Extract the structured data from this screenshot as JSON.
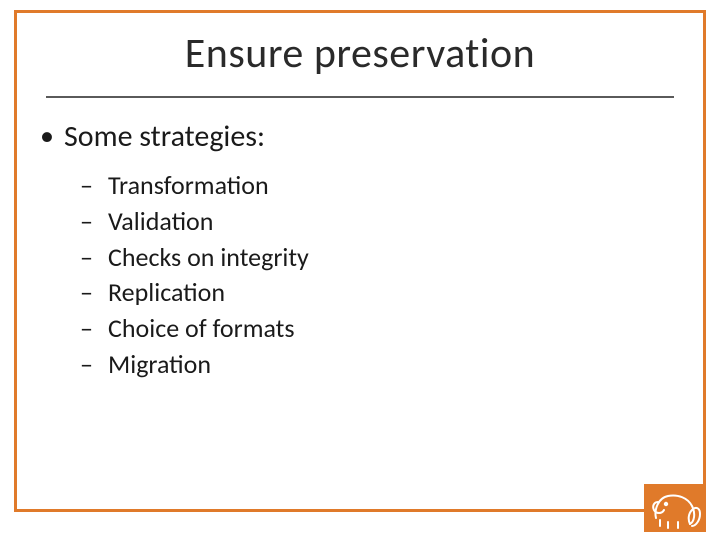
{
  "title": "Ensure preservation",
  "bullets": {
    "main": "Some strategies:",
    "sub": [
      "Transformation",
      "Validation",
      "Checks on integrity",
      "Replication",
      "Choice of formats",
      "Migration"
    ]
  },
  "colors": {
    "accent": "#e07a2a",
    "rule": "#5a5a5a",
    "text": "#1a1a1a"
  }
}
